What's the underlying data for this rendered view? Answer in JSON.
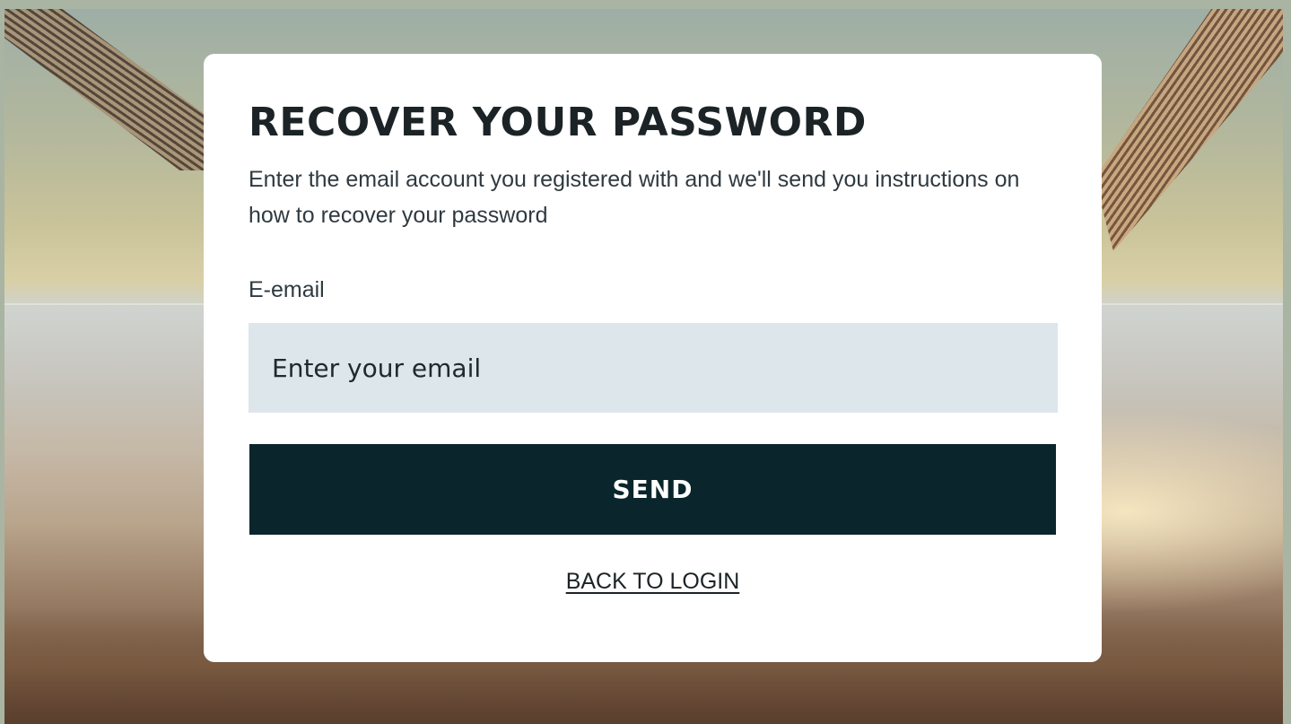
{
  "recover_form": {
    "title": "RECOVER YOUR PASSWORD",
    "subtitle": "Enter the email account you registered with and we'll send you instructions on how to recover your password",
    "email_label": "E-email",
    "email_placeholder": "Enter your email",
    "email_value": "",
    "send_label": "SEND",
    "back_link_label": "BACK TO LOGIN"
  },
  "colors": {
    "card_background": "#ffffff",
    "input_background": "#dde6ea",
    "button_background": "#0b252c",
    "button_text": "#ffffff",
    "heading_text": "#1c2326"
  }
}
